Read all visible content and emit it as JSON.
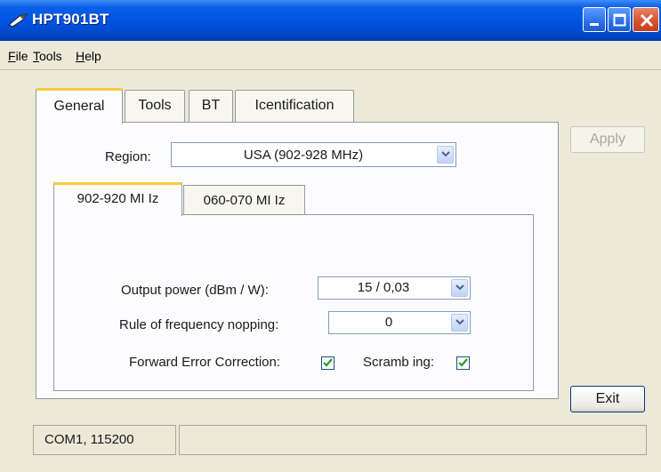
{
  "window": {
    "title": "HPT901BT",
    "controls": [
      "minimize-icon",
      "maximize-icon",
      "close-icon"
    ]
  },
  "menu": {
    "items": [
      {
        "label": "File",
        "mnemonic": "F"
      },
      {
        "label": "Tools",
        "mnemonic": "T"
      },
      {
        "label": "Help",
        "mnemonic": "H"
      }
    ]
  },
  "tabs": [
    {
      "label": "General",
      "active": true
    },
    {
      "label": "Tools",
      "active": false
    },
    {
      "label": "BT",
      "active": false
    },
    {
      "label": "Icentification",
      "active": false
    }
  ],
  "general": {
    "region_label": "Region:",
    "region_value": "USA (902-928 MHz)",
    "subtabs": [
      {
        "label": "902-920 MI Iz",
        "active": true
      },
      {
        "label": "060-070 MI Iz",
        "active": false
      }
    ],
    "output_power_label": "Output power (dBm / W):",
    "output_power_value": "15 / 0,03",
    "hopping_label": "Rule of frequency nopping:",
    "hopping_value": "0",
    "fec_label": "Forward Error Correction:",
    "fec_checked": true,
    "scrambling_label": "Scramb ing:",
    "scrambling_checked": true
  },
  "buttons": {
    "apply_label": "Apply",
    "apply_enabled": false,
    "exit_label": "Exit"
  },
  "status": {
    "port": "COM1, 115200",
    "message": ""
  },
  "colors": {
    "titlebar": "#0054e3",
    "active_tab_highlight": "#ffc83c",
    "window_bg": "#ece9d8",
    "check": "#21a121"
  }
}
